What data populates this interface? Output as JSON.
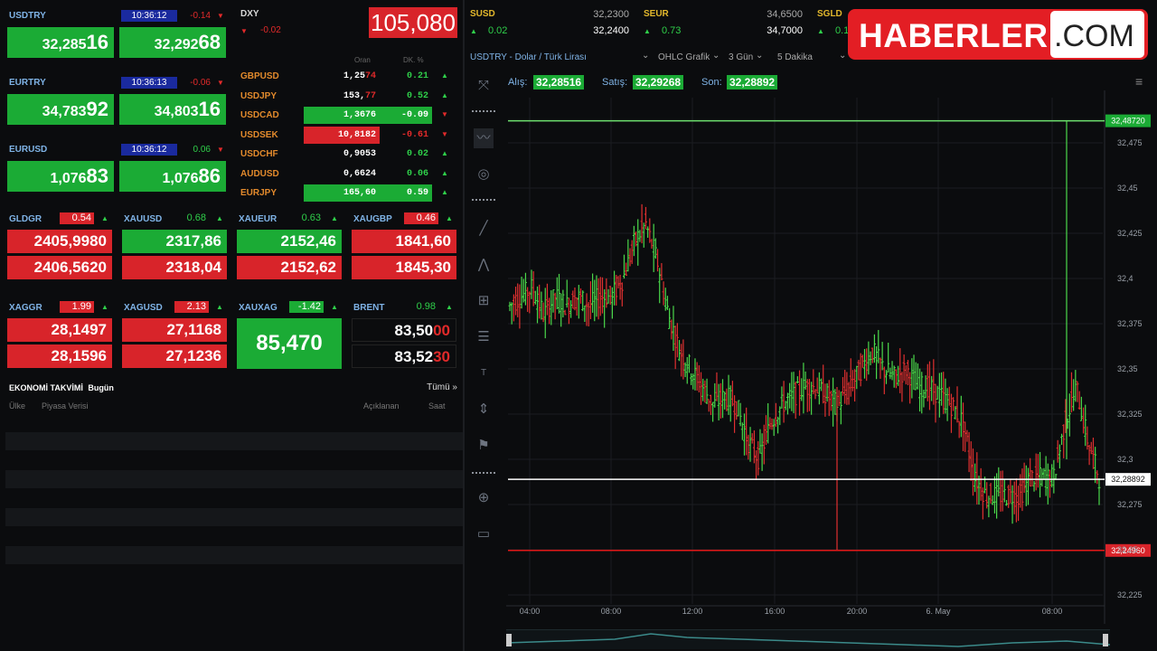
{
  "quotes": [
    {
      "name": "USDTRY",
      "time": "10:36:12",
      "change": "-0.14",
      "dir": "down",
      "bid_main": "32,285",
      "bid_tail": "16",
      "ask_main": "32,292",
      "ask_tail": "68"
    },
    {
      "name": "EURTRY",
      "time": "10:36:13",
      "change": "-0.06",
      "dir": "down",
      "bid_main": "34,783",
      "bid_tail": "92",
      "ask_main": "34,803",
      "ask_tail": "16"
    },
    {
      "name": "EURUSD",
      "time": "10:36:12",
      "change": "0.06",
      "dir": "down",
      "bid_main": "1,076",
      "bid_tail": "83",
      "ask_main": "1,076",
      "ask_tail": "86"
    }
  ],
  "dxy": {
    "name": "DXY",
    "change": "-0.02",
    "value": "105,080"
  },
  "fx_header": {
    "rate": "Oran",
    "change": "DK. %"
  },
  "fx_rows": [
    {
      "name": "GBPUSD",
      "value_main": "1,25",
      "value_tail": "74",
      "change": "0.21",
      "dir": "up",
      "hl": ""
    },
    {
      "name": "USDJPY",
      "value_main": "153,",
      "value_tail": "77",
      "change": "0.52",
      "dir": "up",
      "hl": ""
    },
    {
      "name": "USDCAD",
      "value_main": "1,3676",
      "value_tail": "",
      "change": "-0.09",
      "dir": "down",
      "hl": "green"
    },
    {
      "name": "USDSEK",
      "value_main": "10,8182",
      "value_tail": "",
      "change": "-0.61",
      "dir": "down",
      "hl": "red"
    },
    {
      "name": "USDCHF",
      "value_main": "0,9053",
      "value_tail": "",
      "change": "0.02",
      "dir": "up",
      "hl": ""
    },
    {
      "name": "AUDUSD",
      "value_main": "0,6624",
      "value_tail": "",
      "change": "0.06",
      "dir": "up",
      "hl": ""
    },
    {
      "name": "EURJPY",
      "value_main": "165,60",
      "value_tail": "",
      "change": "0.59",
      "dir": "up",
      "hl": "green"
    }
  ],
  "metals_row1": [
    {
      "name": "GLDGR",
      "change": "0.54",
      "chg_bg": "red",
      "v1": "2405,9980",
      "v2": "2406,5620",
      "c1": "red",
      "c2": "red"
    },
    {
      "name": "XAUUSD",
      "change": "0.68",
      "chg_bg": "",
      "v1": "2317,86",
      "v2": "2318,04",
      "c1": "green",
      "c2": "red"
    },
    {
      "name": "XAUEUR",
      "change": "0.63",
      "chg_bg": "",
      "v1": "2152,46",
      "v2": "2152,62",
      "c1": "green",
      "c2": "red"
    },
    {
      "name": "XAUGBP",
      "change": "0.46",
      "chg_bg": "red",
      "v1": "1841,60",
      "v2": "1845,30",
      "c1": "red",
      "c2": "red"
    }
  ],
  "metals_row2": [
    {
      "name": "XAGGR",
      "change": "1.99",
      "chg_bg": "red",
      "v1": "28,1497",
      "v2": "28,1596"
    },
    {
      "name": "XAGUSD",
      "change": "2.13",
      "chg_bg": "red",
      "v1": "27,1168",
      "v2": "27,1236"
    },
    {
      "name": "XAUXAG",
      "change": "-1.42",
      "chg_bg": "green",
      "single": "85,470"
    },
    {
      "name": "BRENT",
      "change": "0.98",
      "chg_bg": "",
      "v1_main": "83,50",
      "v1_tail": "00",
      "v2_main": "83,52",
      "v2_tail": "30"
    }
  ],
  "calendar": {
    "title": "EKONOMİ TAKVİMİ",
    "sub": "Bugün",
    "all": "Tümü »",
    "cols": [
      "Ülke",
      "Piyasa Verisi",
      "Açıklanan",
      "Saat"
    ]
  },
  "top_tickers": [
    {
      "name": "SUSD",
      "change": "0.02",
      "bid": "32,2300",
      "ask": "32,2400"
    },
    {
      "name": "SEUR",
      "change": "0.73",
      "bid": "34,6500",
      "ask": "34,7000"
    },
    {
      "name": "SGLD",
      "change": "0.1"
    }
  ],
  "chart_toolbar": {
    "symbol": "USDTRY - Dolar / Türk Lirası",
    "type": "OHLC Grafik",
    "range": "3 Gün",
    "interval": "5 Dakika"
  },
  "price_bar": {
    "bid_label": "Alış:",
    "bid": "32,28516",
    "ask_label": "Satış:",
    "ask": "32,29268",
    "last_label": "Son:",
    "last": "32,28892"
  },
  "brand": {
    "name": "HABERLER",
    "suffix": ".COM"
  },
  "chart_data": {
    "type": "ohlc",
    "title": "USDTRY - Dolar / Türk Lirası",
    "x_ticks": [
      "04:00",
      "08:00",
      "12:00",
      "16:00",
      "20:00",
      "6. May",
      "08:00"
    ],
    "y_ticks": [
      "32,475",
      "32,45",
      "32,425",
      "32,4",
      "32,375",
      "32,35",
      "32,325",
      "32,3",
      "32,275",
      "32,25",
      "32,225"
    ],
    "ylim": [
      32.22,
      32.5
    ],
    "levels": {
      "high": "32,48720",
      "current": "32,28892",
      "low": "32,24960"
    },
    "level_values": {
      "high": 32.4872,
      "current": 32.28892,
      "low": 32.2496
    },
    "path": [
      32.385,
      32.39,
      32.395,
      32.38,
      32.39,
      32.385,
      32.39,
      32.385,
      32.39,
      32.39,
      32.4,
      32.42,
      32.43,
      32.41,
      32.38,
      32.36,
      32.35,
      32.34,
      32.33,
      32.335,
      32.33,
      32.31,
      32.3,
      32.32,
      32.33,
      32.335,
      32.34,
      32.34,
      32.335,
      32.33,
      32.34,
      32.35,
      32.36,
      32.35,
      32.345,
      32.35,
      32.34,
      32.34,
      32.335,
      32.33,
      32.32,
      32.29,
      32.28,
      32.28,
      32.28,
      32.28,
      32.29,
      32.29,
      32.29,
      32.32,
      32.34,
      32.31,
      32.29
    ],
    "grid": true
  }
}
